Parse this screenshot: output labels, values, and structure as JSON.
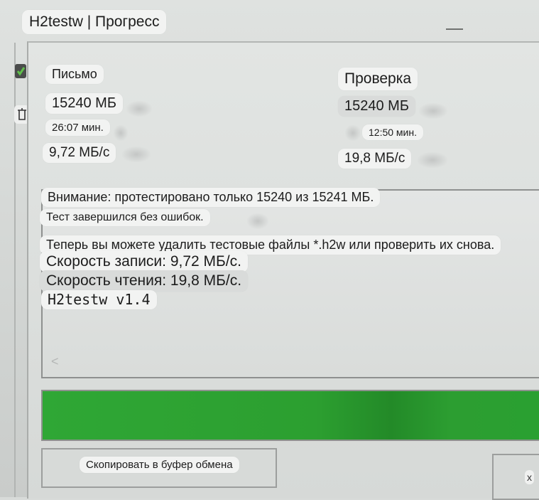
{
  "window": {
    "title": "H2testw | Прогресс"
  },
  "write": {
    "label": "Письмо",
    "size": "15240 МБ",
    "time": "26:07 мин.",
    "speed": "9,72 МБ/с"
  },
  "verify": {
    "label": "Проверка",
    "size": "15240 МБ",
    "time": "12:50 мин.",
    "speed": "19,8 МБ/с"
  },
  "log": {
    "lines": [
      "Внимание: протестировано только 15240 из 15241 МБ.",
      "Тест завершился без ошибок.",
      "Теперь вы можете удалить тестовые файлы *.h2w или проверить их снова.",
      "Скорость записи: 9,72 МБ/с.",
      "Скорость чтения: 19,8 МБ/с.",
      "H2testw v1.4"
    ],
    "scroll_glyph": "<"
  },
  "progress": {
    "fraction": 1.0,
    "color": "#2ca032"
  },
  "buttons": {
    "copy_label": "Скопировать в буфер обмена",
    "close_label_visible": "х"
  },
  "icons": {
    "minimize": "minimize-icon",
    "side_top": "app-icon",
    "side_bottom": "trash-icon"
  }
}
